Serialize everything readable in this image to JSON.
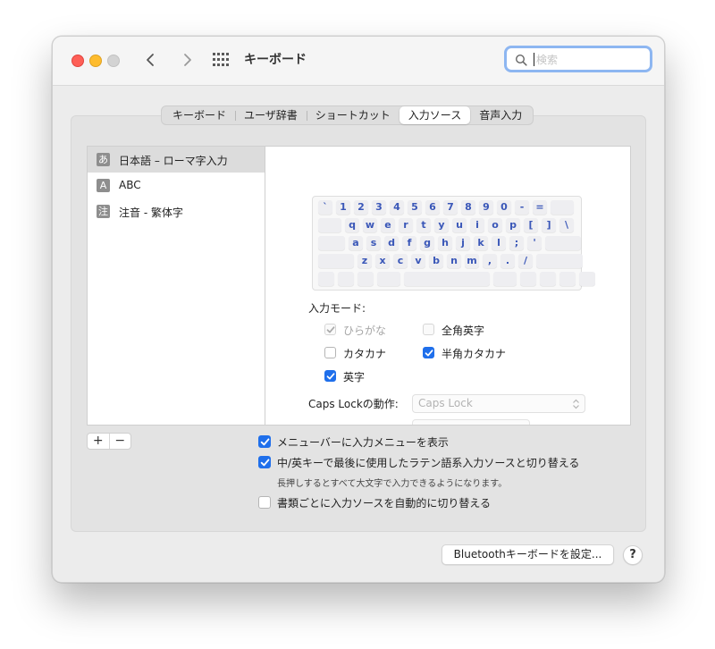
{
  "window": {
    "title": "キーボード",
    "search": {
      "placeholder": "検索"
    }
  },
  "tabs": [
    {
      "label": "キーボード",
      "active": false
    },
    {
      "label": "ユーザ辞書",
      "active": false
    },
    {
      "label": "ショートカット",
      "active": false
    },
    {
      "label": "入力ソース",
      "active": true
    },
    {
      "label": "音声入力",
      "active": false
    }
  ],
  "sources": [
    {
      "icon": "あ",
      "label": "日本語 – ローマ字入力",
      "selected": true
    },
    {
      "icon": "A",
      "label": "ABC",
      "selected": false
    },
    {
      "icon": "注",
      "label": "注音 - 繁体字",
      "selected": false
    }
  ],
  "keyboard": {
    "row1": [
      "`",
      "1",
      "2",
      "3",
      "4",
      "5",
      "6",
      "7",
      "8",
      "9",
      "0",
      "-",
      "="
    ],
    "row2": [
      "q",
      "w",
      "e",
      "r",
      "t",
      "y",
      "u",
      "i",
      "o",
      "p",
      "[",
      "]",
      "\\"
    ],
    "row3": [
      "a",
      "s",
      "d",
      "f",
      "g",
      "h",
      "j",
      "k",
      "l",
      ";",
      "'"
    ],
    "row4": [
      "z",
      "x",
      "c",
      "v",
      "b",
      "n",
      "m",
      ",",
      ".",
      "/"
    ]
  },
  "input_mode": {
    "label": "入力モード:",
    "options": {
      "hiragana": {
        "label": "ひらがな",
        "checked": true,
        "enabled": false
      },
      "zenkaku_eiji": {
        "label": "全角英字",
        "checked": false,
        "enabled": false
      },
      "katakana": {
        "label": "カタカナ",
        "checked": false,
        "enabled": true
      },
      "hankaku_katakana": {
        "label": "半角カタカナ",
        "checked": true,
        "enabled": true
      },
      "eiji": {
        "label": "英字",
        "checked": true,
        "enabled": true
      }
    }
  },
  "caps_lock": {
    "label": "Caps Lockの動作:",
    "value": "Caps Lock"
  },
  "list_buttons": {
    "add": "+",
    "remove": "−"
  },
  "options": {
    "show_menu": {
      "label": "メニューバーに入力メニューを表示",
      "checked": true
    },
    "switch_latin": {
      "label": "中/英キーで最後に使用したラテン語系入力ソースと切り替える",
      "note": "長押しするとすべて大文字で入力できるようになります。",
      "checked": true
    },
    "auto_switch": {
      "label": "書類ごとに入力ソースを自動的に切り替える",
      "checked": false
    }
  },
  "bluetooth_button": "Bluetoothキーボードを設定...",
  "help_button": "?",
  "colors": {
    "accent": "#1f6feb",
    "key_text": "#3a57b8",
    "search_focus": "#8db6f1",
    "traffic_red": "#fe5f57",
    "traffic_yellow": "#febc2e",
    "traffic_gray": "#d3d3d3"
  }
}
